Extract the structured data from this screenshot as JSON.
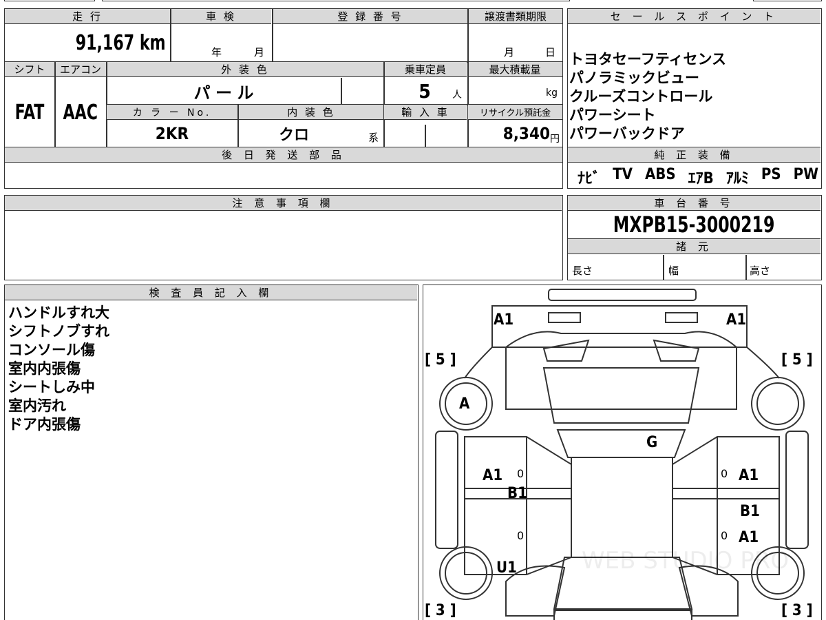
{
  "mileage": {
    "label": "走 行",
    "value": "91,167 km"
  },
  "shaken": {
    "label": "車 検",
    "year_unit": "年",
    "month_unit": "月"
  },
  "registration": {
    "label": "登 録 番 号",
    "value": ""
  },
  "transfer": {
    "label": "譲渡書類期限",
    "month_unit": "月",
    "day_unit": "日"
  },
  "shift": {
    "label": "シフト",
    "value": "FAT"
  },
  "aircon": {
    "label": "エアコン",
    "value": "AAC"
  },
  "exterior": {
    "label": "外 装 色",
    "value": "パ ー ル"
  },
  "capacity": {
    "label": "乗車定員",
    "value": "5",
    "unit": "人"
  },
  "maxload": {
    "label": "最大積載量",
    "unit": "kg"
  },
  "color_no": {
    "label": "カ ラ ー No.",
    "value": "2KR"
  },
  "interior": {
    "label": "内 装 色",
    "value": "クロ",
    "unit": "系"
  },
  "import": {
    "label": "輸 入 車"
  },
  "recycle": {
    "label": "リサイクル預託金",
    "value": "8,340",
    "unit": "円"
  },
  "later_parts": {
    "label": "後 日 発 送 部 品"
  },
  "sales_points": {
    "label": "セ ー ル ス ポ イ ン ト",
    "items": [
      "トヨタセーフティセンス",
      "パノラミックビュー",
      "クルーズコントロール",
      "パワーシート",
      "パワーバックドア"
    ]
  },
  "equipment": {
    "label": "純 正 装 備",
    "items": [
      "ﾅﾋﾞ",
      "TV",
      "ABS",
      "ｴｱB",
      "ｱﾙﾐ",
      "PS",
      "PW"
    ]
  },
  "notes": {
    "label": "注 意 事 項 欄"
  },
  "chassis": {
    "label": "車 台 番 号",
    "value": "MXPB15-3000219"
  },
  "specs": {
    "label": "諸 元",
    "length": "長さ",
    "width": "幅",
    "height": "高さ"
  },
  "inspector": {
    "label": "検 査 員 記 入 欄",
    "items": [
      "ハンドルすれ大",
      "シフトノブすれ",
      "コンソール傷",
      "室内内張傷",
      "シートしみ中",
      "室内汚れ",
      "ドア内張傷"
    ]
  },
  "diagram": {
    "marks": {
      "front_left": "A1",
      "front_right": "A1",
      "tire_fl": "[ 5 ]",
      "tire_fr": "[ 5 ]",
      "tire_rl": "[ 3 ]",
      "tire_rr": "[ 3 ]",
      "wheel_a": "A",
      "glass": "G",
      "door_fl": "A1",
      "door_fl2": "B1",
      "door_fr": "A1",
      "door_rr": "B1",
      "door_rr2": "A1",
      "rear_left": "U1",
      "zero1": "0",
      "zero2": "0",
      "zero3": "0",
      "zero4": "0"
    },
    "watermark": "WEB STUDIO PRO"
  }
}
